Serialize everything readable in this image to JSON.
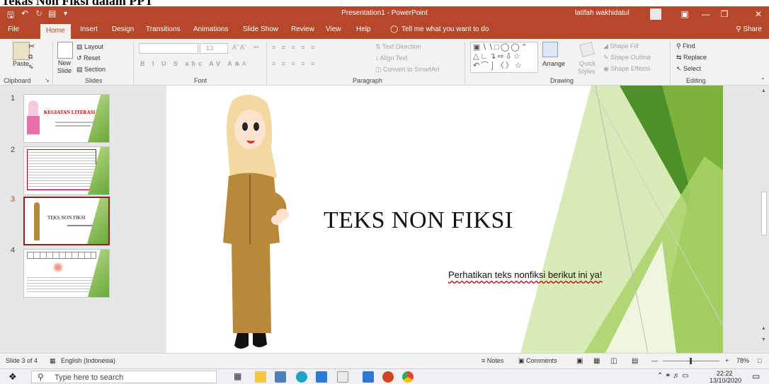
{
  "doc_heading": "Tekas Non Fiksi dalam PPT",
  "app": {
    "window_title": "Presentation1  -  PowerPoint",
    "user_name": "latifah wakhidatul"
  },
  "tabs": [
    "File",
    "Home",
    "Insert",
    "Design",
    "Transitions",
    "Animations",
    "Slide Show",
    "Review",
    "View",
    "Help"
  ],
  "tell_me": "Tell me what you want to do",
  "share": "Share",
  "ribbon": {
    "clipboard": {
      "label": "Clipboard",
      "paste": "Paste"
    },
    "slides": {
      "label": "Slides",
      "new_slide_1": "New",
      "new_slide_2": "Slide",
      "layout": "Layout",
      "reset": "Reset",
      "section": "Section"
    },
    "font": {
      "label": "Font",
      "size": "13"
    },
    "paragraph": {
      "label": "Paragraph",
      "text_direction": "Text Direction",
      "align_text": "Align Text",
      "convert": "Convert to SmartArt"
    },
    "drawing": {
      "label": "Drawing",
      "arrange": "Arrange",
      "quick_styles_1": "Quick",
      "quick_styles_2": "Styles",
      "shape_fill": "Shape Fill",
      "shape_outline": "Shape Outline",
      "shape_effects": "Shape Effects"
    },
    "editing": {
      "label": "Editing",
      "find": "Find",
      "replace": "Replace",
      "select": "Select"
    }
  },
  "thumbnails": [
    {
      "num": "1",
      "title": "KEGIATAN LITERASI"
    },
    {
      "num": "2",
      "title": ""
    },
    {
      "num": "3",
      "title": "TEKS NON FIKSI"
    },
    {
      "num": "4",
      "title": ""
    }
  ],
  "slide": {
    "title": "TEKS NON FIKSI",
    "subtitle": "Perhatikan teks nonfiksi berikut ini ya!"
  },
  "status": {
    "slide_info": "Slide 3 of 4",
    "language": "English (Indonesia)",
    "notes": "Notes",
    "comments": "Comments",
    "zoom": "78%"
  },
  "taskbar": {
    "search_placeholder": "Type here to search",
    "time": "22:22",
    "date": "13/10/2020"
  },
  "colors": {
    "accent": "#b7472a",
    "slide_green": "#7bb33a"
  }
}
